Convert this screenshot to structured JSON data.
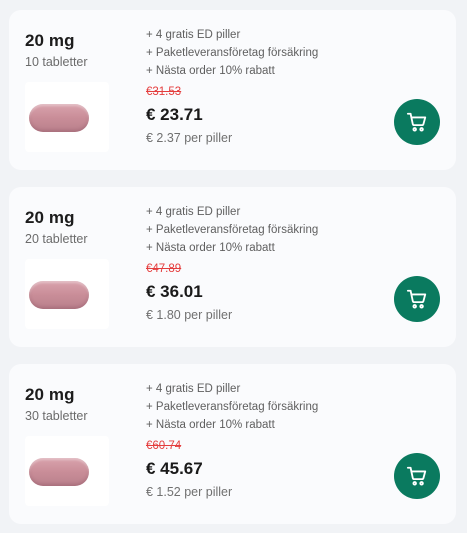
{
  "offers": [
    {
      "dose": "20 mg",
      "quantity": "10 tabletter",
      "benefits": [
        "+ 4 gratis ED piller",
        "+ Paketleveransföretag försäkring",
        "+ Nästa order 10% rabatt"
      ],
      "old_price": "€31.53",
      "price": "€ 23.71",
      "per_pill": "€ 2.37 per piller",
      "cart_icon": "cart-icon"
    },
    {
      "dose": "20 mg",
      "quantity": "20 tabletter",
      "benefits": [
        "+ 4 gratis ED piller",
        "+ Paketleveransföretag försäkring",
        "+ Nästa order 10% rabatt"
      ],
      "old_price": "€47.89",
      "price": "€ 36.01",
      "per_pill": "€ 1.80 per piller",
      "cart_icon": "cart-icon"
    },
    {
      "dose": "20 mg",
      "quantity": "30 tabletter",
      "benefits": [
        "+ 4 gratis ED piller",
        "+ Paketleveransföretag försäkring",
        "+ Nästa order 10% rabatt"
      ],
      "old_price": "€60.74",
      "price": "€ 45.67",
      "per_pill": "€ 1.52 per piller",
      "cart_icon": "cart-icon"
    }
  ],
  "colors": {
    "accent": "#0a7a5f",
    "old_price": "#e43d3d",
    "pill": "#c98d98"
  }
}
